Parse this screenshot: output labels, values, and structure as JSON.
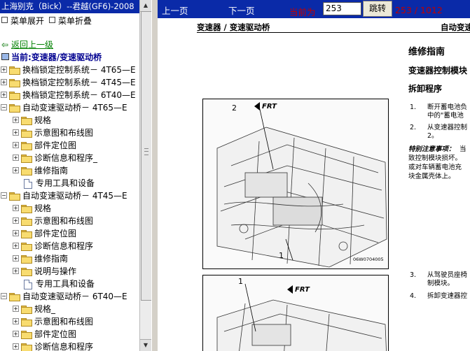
{
  "left_panel": {
    "title": "上海别克（Bick）--君越(GF6)-2008",
    "expand_label": "菜单展开",
    "collapse_label": "菜单折叠",
    "back_link": "返回上一级",
    "current": "当前:变速器/变速驱动桥",
    "tree": [
      {
        "label": "换档锁定控制系统－  4T65—E",
        "level": 0,
        "icon": "folder",
        "expanded": false
      },
      {
        "label": "换档锁定控制系统－  4T45—E",
        "level": 0,
        "icon": "folder",
        "expanded": false
      },
      {
        "label": "换档锁定控制系统－  6T40—E",
        "level": 0,
        "icon": "folder",
        "expanded": false
      },
      {
        "label": "自动变速驱动桥－  4T65—E",
        "level": 0,
        "icon": "folder",
        "expanded": true
      },
      {
        "label": "规格",
        "level": 1,
        "icon": "folder",
        "expanded": false
      },
      {
        "label": "示意图和布线图",
        "level": 1,
        "icon": "folder",
        "expanded": false
      },
      {
        "label": "部件定位图",
        "level": 1,
        "icon": "folder",
        "expanded": false
      },
      {
        "label": "诊断信息和程序_",
        "level": 1,
        "icon": "folder",
        "expanded": false
      },
      {
        "label": "维修指南",
        "level": 1,
        "icon": "folder",
        "expanded": false
      },
      {
        "label": "专用工具和设备",
        "level": 1,
        "icon": "doc",
        "expanded": false
      },
      {
        "label": "自动变速驱动桥－  4T45—E",
        "level": 0,
        "icon": "folder",
        "expanded": true
      },
      {
        "label": "规格",
        "level": 1,
        "icon": "folder",
        "expanded": false
      },
      {
        "label": "示意图和布线图",
        "level": 1,
        "icon": "folder",
        "expanded": false
      },
      {
        "label": "部件定位图",
        "level": 1,
        "icon": "folder",
        "expanded": false
      },
      {
        "label": "诊断信息和程序",
        "level": 1,
        "icon": "folder",
        "expanded": false
      },
      {
        "label": "维修指南",
        "level": 1,
        "icon": "folder",
        "expanded": false
      },
      {
        "label": "说明与操作",
        "level": 1,
        "icon": "folder",
        "expanded": false
      },
      {
        "label": "专用工具和设备",
        "level": 1,
        "icon": "doc",
        "expanded": false
      },
      {
        "label": "自动变速驱动桥－  6T40—E",
        "level": 0,
        "icon": "folder",
        "expanded": true
      },
      {
        "label": "规格_",
        "level": 1,
        "icon": "folder",
        "expanded": false
      },
      {
        "label": "示意图和布线图",
        "level": 1,
        "icon": "folder",
        "expanded": false
      },
      {
        "label": "部件定位图",
        "level": 1,
        "icon": "folder",
        "expanded": false
      },
      {
        "label": "诊断信息和程序",
        "level": 1,
        "icon": "folder",
        "expanded": false
      }
    ]
  },
  "toolbar": {
    "prev": "上一页",
    "next": "下一页",
    "current_label": "当前为",
    "page_value": "253",
    "jump": "跳转",
    "pages": "253 / 1012"
  },
  "document": {
    "header_left": "变速器 / 变速驱动桥",
    "header_right": "自动变速",
    "h_repair": "维修指南",
    "h_module": "变速器控制模块",
    "h_procedure": "拆卸程序",
    "step1_num": "1.",
    "step1_line1": "断开蓄电池负",
    "step1_line2": "中的\"蓄电池",
    "step2_num": "2.",
    "step2_line1": "从变速器控制",
    "step2_line2": "2。",
    "note_label": "特别注意事项：",
    "note_line1": "当",
    "note_line2": "致控制模块损坏。",
    "note_line3": "或对车辆蓄电池充",
    "note_line4": "块金属壳体上。",
    "step3_num": "3.",
    "step3_line1": "从驾驶员座椅",
    "step3_line2": "制模块。",
    "step4_num": "4.",
    "step4_line1": "拆卸变速器控",
    "fig1_frt": "FRT",
    "fig1_callout1": "1",
    "fig1_callout2": "2",
    "fig1_code": "06W0704005",
    "fig2_frt": "FRT",
    "fig2_callout1": "1"
  },
  "colors": {
    "title_bar": "#0a2aa8",
    "link_green": "#008000",
    "current_blue": "#000090",
    "page_red": "#c00000",
    "folder": "#f8dc70"
  }
}
